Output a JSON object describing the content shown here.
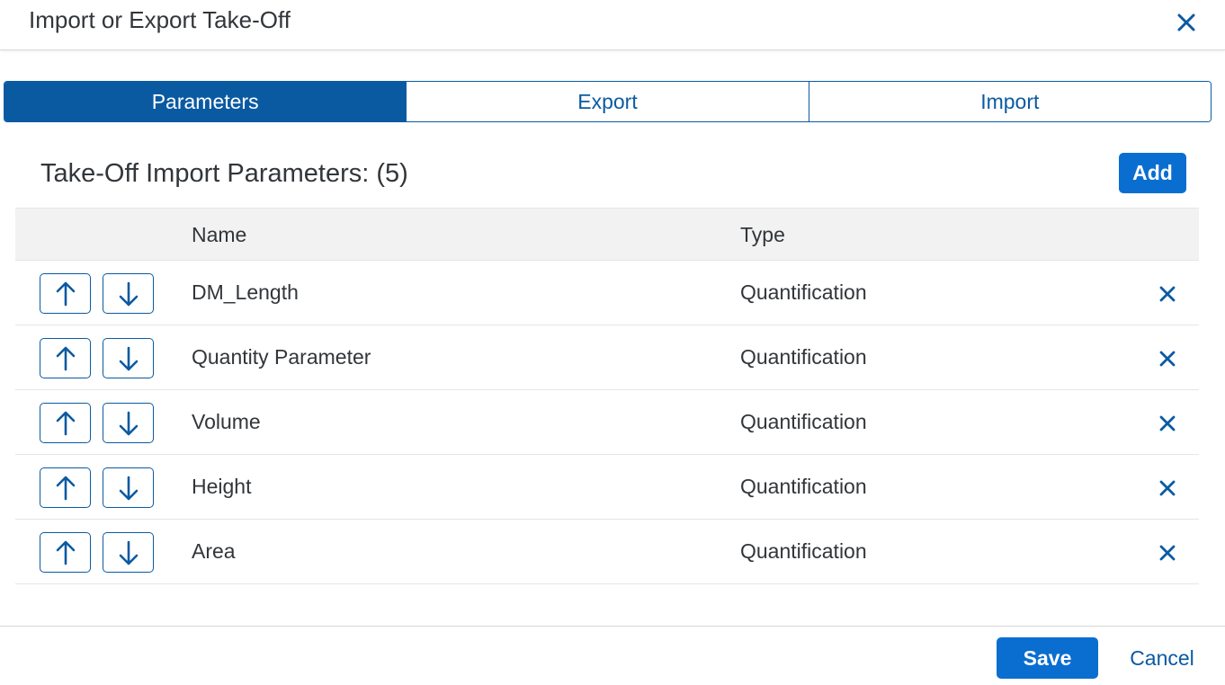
{
  "dialog": {
    "title": "Import or Export Take-Off",
    "close_icon": "close-icon"
  },
  "tabs": [
    {
      "label": "Parameters",
      "active": true
    },
    {
      "label": "Export",
      "active": false
    },
    {
      "label": "Import",
      "active": false
    }
  ],
  "section": {
    "title": "Take-Off Import Parameters: (5)",
    "add_label": "Add"
  },
  "table": {
    "columns": {
      "name": "Name",
      "type": "Type"
    },
    "rows": [
      {
        "name": "DM_Length",
        "type": "Quantification"
      },
      {
        "name": "Quantity Parameter",
        "type": "Quantification"
      },
      {
        "name": "Volume",
        "type": "Quantification"
      },
      {
        "name": "Height",
        "type": "Quantification"
      },
      {
        "name": "Area",
        "type": "Quantification"
      }
    ]
  },
  "footer": {
    "save_label": "Save",
    "cancel_label": "Cancel"
  },
  "colors": {
    "accent": "#0a6ed1",
    "brand_dark": "#0a5aa2",
    "header_bg": "#f2f2f2"
  }
}
